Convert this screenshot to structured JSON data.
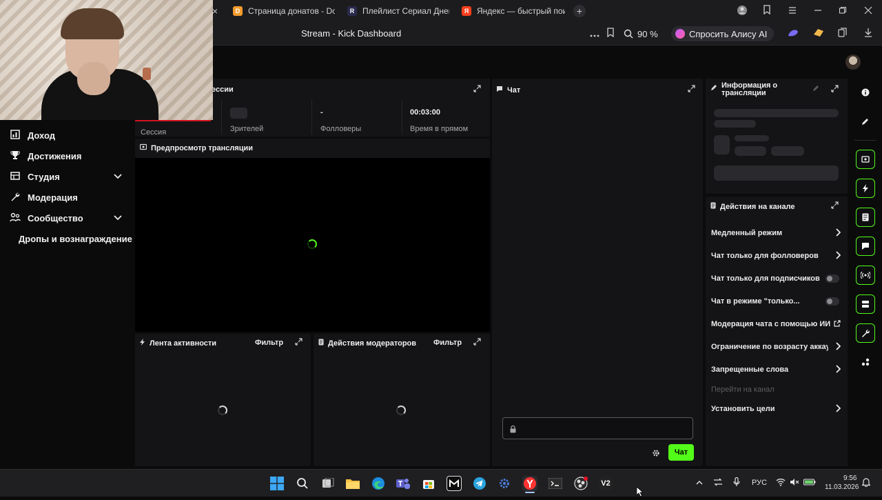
{
  "browser": {
    "tabs": [
      {
        "label": "Страница донатов - Dona",
        "favicon": "D"
      },
      {
        "label": "Плейлист Сериал Дневни",
        "favicon": "R"
      },
      {
        "label": "Яндекс — быстрый поиск",
        "favicon": "Я"
      }
    ],
    "page_title": "Stream - Kick Dashboard",
    "zoom": "90 %",
    "alice_label": "Спросить Алису AI",
    "close_tab_glyph": "×",
    "new_tab_glyph": "+"
  },
  "sidebar": {
    "items": [
      {
        "label": "Доход",
        "icon": "bar-chart-icon",
        "glyph": "▥",
        "chevron": false
      },
      {
        "label": "Достижения",
        "icon": "trophy-icon",
        "glyph": "🏆",
        "chevron": false
      },
      {
        "label": "Студия",
        "icon": "studio-icon",
        "glyph": "▤",
        "chevron": true
      },
      {
        "label": "Модерация",
        "icon": "wrench-icon",
        "glyph": "🔧",
        "chevron": false
      },
      {
        "label": "Сообщество",
        "icon": "community-icon",
        "glyph": "👥",
        "chevron": true
      },
      {
        "label": "Дропы и вознаграждение",
        "icon": "",
        "glyph": "",
        "chevron": false
      }
    ]
  },
  "session": {
    "title_visible": "ессии",
    "stats": [
      {
        "label": "Сессия",
        "value": ""
      },
      {
        "label": "Зрителей",
        "value": ""
      },
      {
        "label": "Фолловеры",
        "value": "-"
      },
      {
        "label": "Время в прямом",
        "value": "00:03:00"
      }
    ]
  },
  "preview": {
    "title": "Предпросмотр трансляции"
  },
  "activity": {
    "title": "Лента активности",
    "filter": "Фильтр"
  },
  "mod_actions": {
    "title": "Действия модераторов",
    "filter": "Фильтр"
  },
  "chat": {
    "title": "Чат",
    "send_label": "Чат"
  },
  "stream_info": {
    "title_line1": "Информация о",
    "title_line2": "трансляции"
  },
  "channel_actions": {
    "title": "Действия на канале",
    "items": [
      {
        "label": "Медленный режим",
        "control": "chevron"
      },
      {
        "label": "Чат только для фолловеров",
        "control": "chevron"
      },
      {
        "label": "Чат только для подписчиков",
        "control": "toggle"
      },
      {
        "label": "Чат в режиме \"только...",
        "control": "toggle"
      },
      {
        "label": "Модерация чата с помощью ИИ",
        "control": "external"
      },
      {
        "label": "Ограничение по возрасту аккаунта",
        "control": "chevron"
      },
      {
        "label": "Запрещенные слова",
        "control": "chevron"
      },
      {
        "label": "Перейти на канал",
        "control": "none"
      },
      {
        "label": "Установить цели",
        "control": "chevron"
      }
    ]
  },
  "taskbar": {
    "lang": "РУС",
    "time": "9:56",
    "date": "11.03.2026",
    "v2_label": "V2"
  },
  "colors": {
    "accent": "#53fc18",
    "panel_bg": "#141416",
    "page_bg": "#0b0b0c"
  }
}
